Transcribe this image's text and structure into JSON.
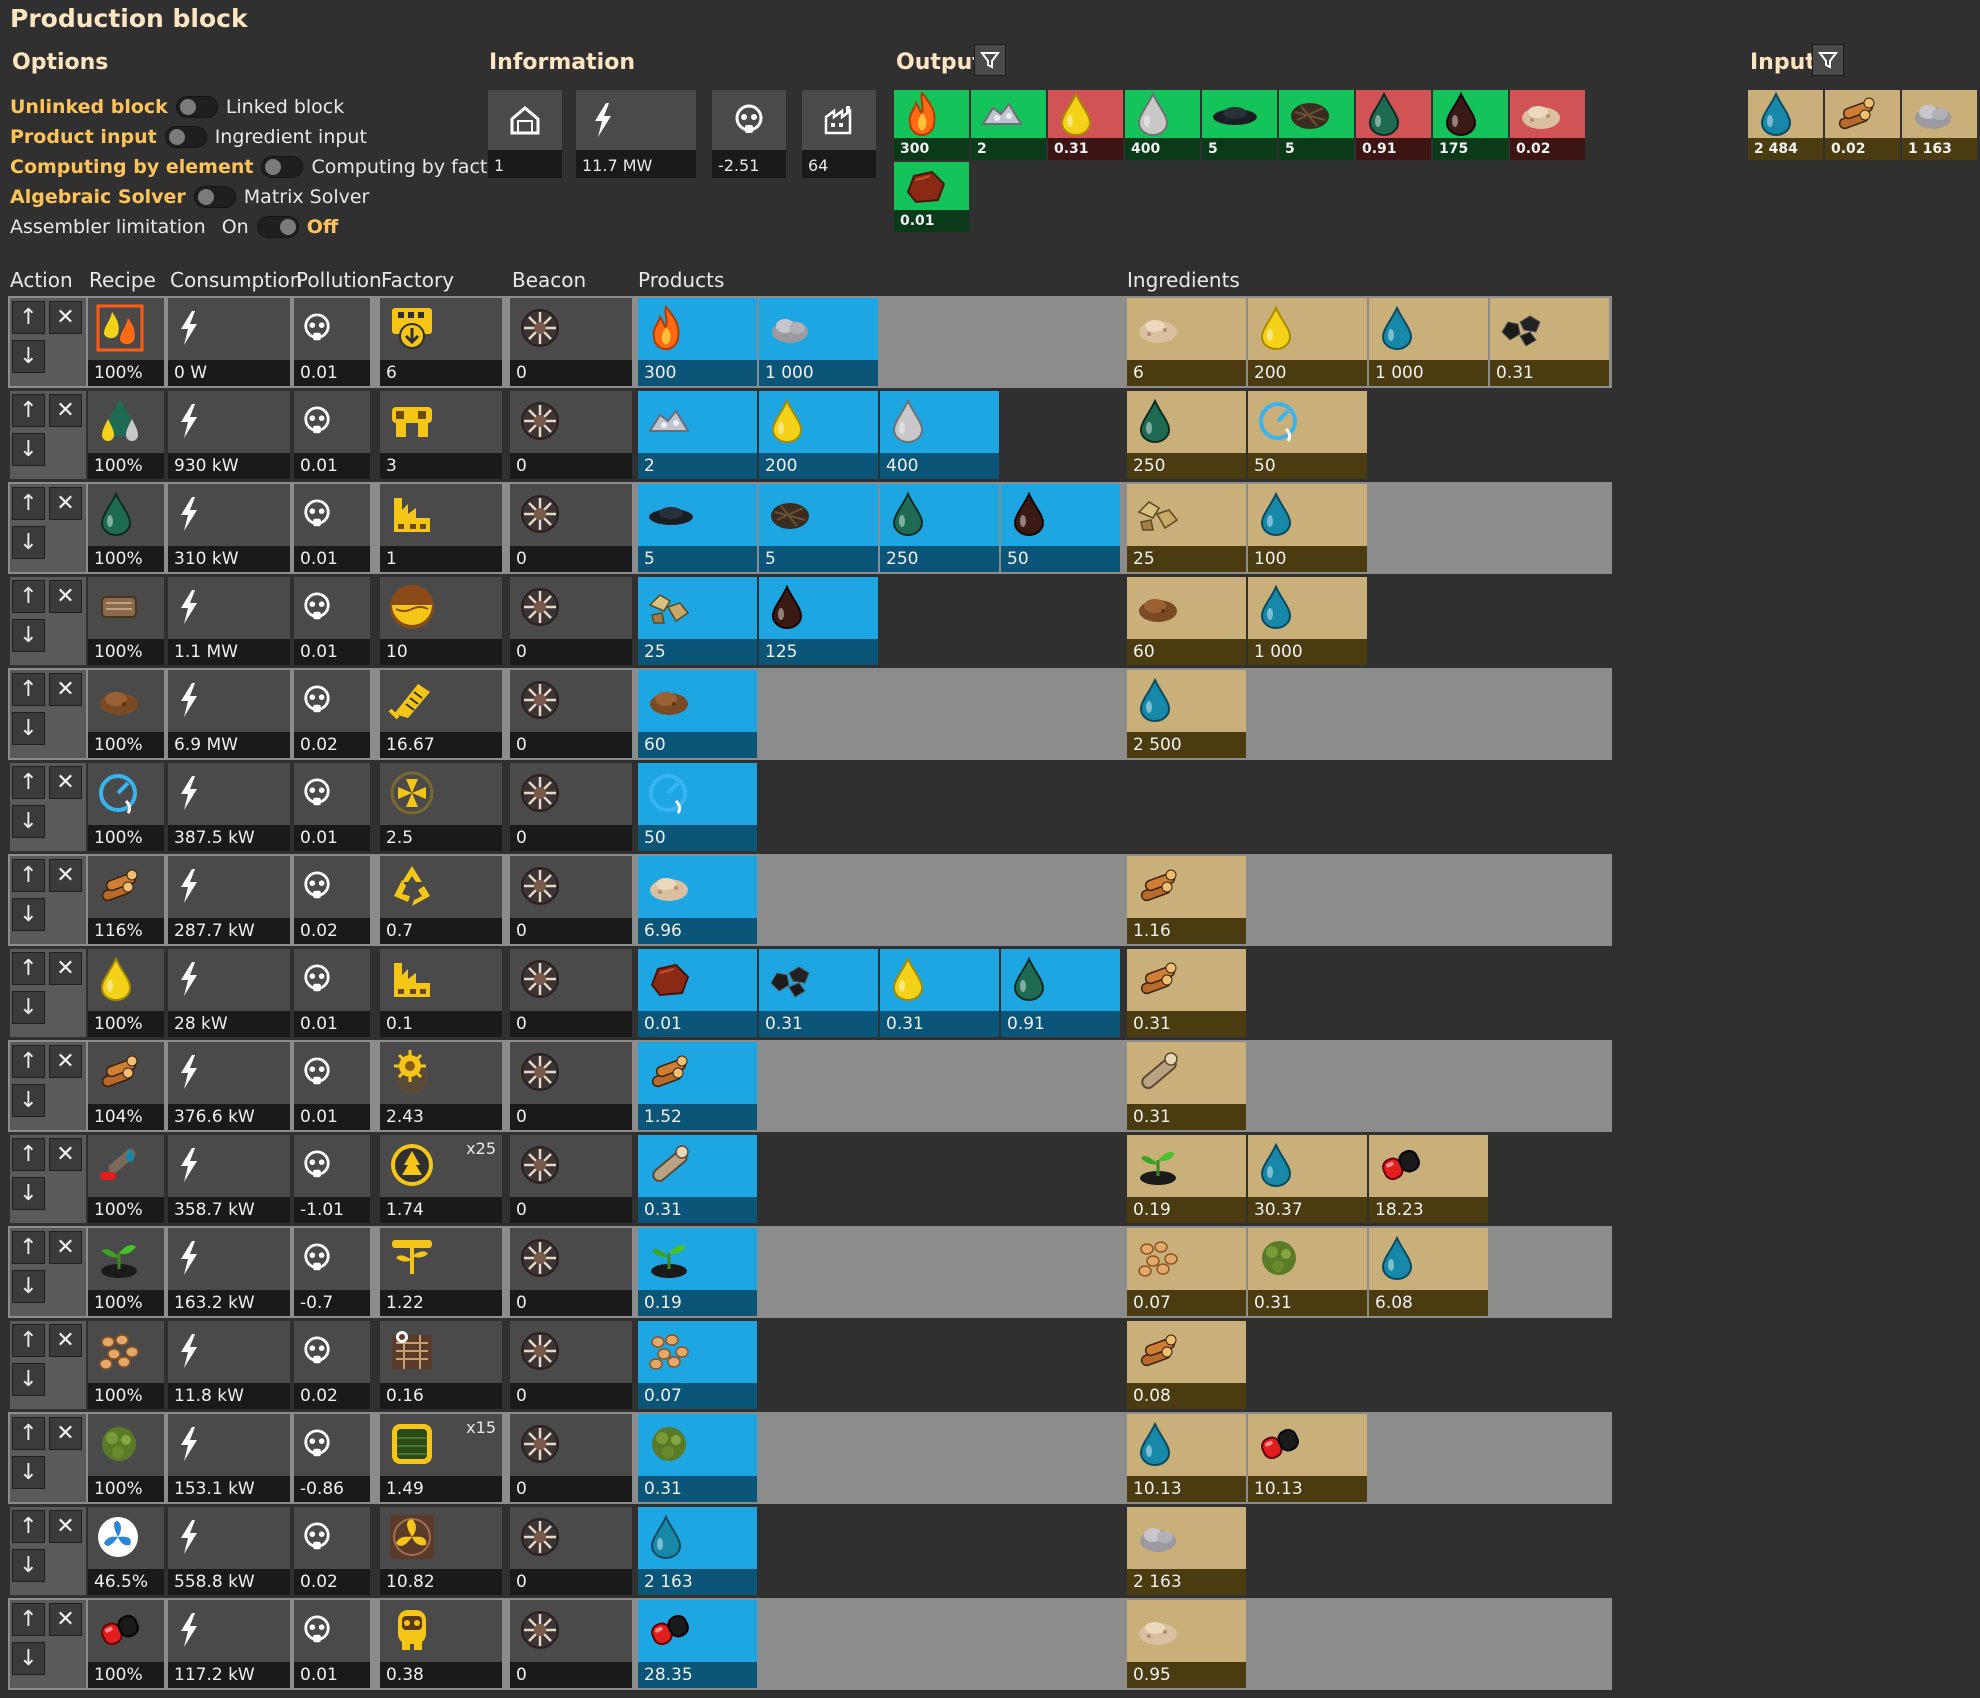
{
  "title": "Production block",
  "options": {
    "heading": "Options",
    "unlinked": "Unlinked block",
    "linked": "Linked block",
    "product_input": "Product input",
    "ingredient_input": "Ingredient input",
    "by_element": "Computing by element",
    "by_factory": "Computing by factory",
    "algebraic": "Algebraic Solver",
    "matrix": "Matrix Solver",
    "assembler_limit": "Assembler limitation",
    "on": "On",
    "off": "Off"
  },
  "information": {
    "heading": "Information",
    "block_count": "1",
    "power": "11.7 MW",
    "pollution": "-2.51",
    "factories": "64"
  },
  "output": {
    "heading": "Output",
    "items": [
      {
        "icon": "flame-fluid-icon",
        "value": "300",
        "status": "green"
      },
      {
        "icon": "ore-pile-icon",
        "value": "2",
        "status": "green"
      },
      {
        "icon": "yellow-drop-icon",
        "value": "0.31",
        "status": "red"
      },
      {
        "icon": "grey-drop-icon",
        "value": "400",
        "status": "green"
      },
      {
        "icon": "black-powder-icon",
        "value": "5",
        "status": "green"
      },
      {
        "icon": "brown-fibre-icon",
        "value": "5",
        "status": "green"
      },
      {
        "icon": "green-drop-icon",
        "value": "0.91",
        "status": "red"
      },
      {
        "icon": "dark-drop-icon",
        "value": "175",
        "status": "green"
      },
      {
        "icon": "sawdust-icon",
        "value": "0.02",
        "status": "red"
      },
      {
        "icon": "red-rock-icon",
        "value": "0.01",
        "status": "green"
      }
    ]
  },
  "input": {
    "heading": "Input",
    "items": [
      {
        "icon": "water-drop-icon",
        "value": "2 484"
      },
      {
        "icon": "wood-logs-icon",
        "value": "0.02"
      },
      {
        "icon": "ash-pile-icon",
        "value": "1 163"
      }
    ]
  },
  "columns": {
    "action": "Action",
    "recipe": "Recipe",
    "consumption": "Consumption",
    "pollution": "Pollution",
    "factory": "Factory",
    "beacon": "Beacon",
    "products": "Products",
    "ingredients": "Ingredients"
  },
  "rows": [
    {
      "recipe_icon": "burning-fluids-recipe-icon",
      "recipe_pct": "100%",
      "consumption": "0 W",
      "pollution": "0.01",
      "factory_icon": "boiler-icon",
      "factory_count": "6",
      "factory_tag": "",
      "beacon": "0",
      "products": [
        {
          "icon": "flame-fluid-icon",
          "value": "300"
        },
        {
          "icon": "ash-pile-icon",
          "value": "1 000"
        }
      ],
      "ingredients": [
        {
          "icon": "sawdust-icon",
          "value": "6"
        },
        {
          "icon": "yellow-drop-icon",
          "value": "200"
        },
        {
          "icon": "water-drop-icon",
          "value": "1 000"
        },
        {
          "icon": "coal-icon",
          "value": "0.31"
        }
      ]
    },
    {
      "recipe_icon": "oil-split-recipe-icon",
      "recipe_pct": "100%",
      "consumption": "930 kW",
      "pollution": "0.01",
      "factory_icon": "refinery-icon",
      "factory_count": "3",
      "factory_tag": "",
      "beacon": "0",
      "products": [
        {
          "icon": "ore-pile-icon",
          "value": "2"
        },
        {
          "icon": "yellow-drop-icon",
          "value": "200"
        },
        {
          "icon": "grey-drop-icon",
          "value": "400"
        }
      ],
      "ingredients": [
        {
          "icon": "green-drop-icon",
          "value": "250"
        },
        {
          "icon": "steam-gauge-icon",
          "value": "50"
        }
      ]
    },
    {
      "recipe_icon": "green-drop-icon",
      "recipe_pct": "100%",
      "consumption": "310 kW",
      "pollution": "0.01",
      "factory_icon": "chemical-plant-icon",
      "factory_count": "1",
      "factory_tag": "",
      "beacon": "0",
      "products": [
        {
          "icon": "black-powder-icon",
          "value": "5"
        },
        {
          "icon": "brown-fibre-icon",
          "value": "5"
        },
        {
          "icon": "green-drop-icon",
          "value": "250"
        },
        {
          "icon": "dark-drop-icon",
          "value": "50"
        }
      ],
      "ingredients": [
        {
          "icon": "rock-chunks-icon",
          "value": "25"
        },
        {
          "icon": "water-drop-icon",
          "value": "100"
        }
      ]
    },
    {
      "recipe_icon": "mud-sieve-recipe-icon",
      "recipe_pct": "100%",
      "consumption": "1.1 MW",
      "pollution": "0.01",
      "factory_icon": "washer-icon",
      "factory_count": "10",
      "factory_tag": "",
      "beacon": "0",
      "products": [
        {
          "icon": "rock-chunks-icon",
          "value": "25"
        },
        {
          "icon": "dark-drop-icon",
          "value": "125"
        }
      ],
      "ingredients": [
        {
          "icon": "dirt-pile-icon",
          "value": "60"
        },
        {
          "icon": "water-drop-icon",
          "value": "1 000"
        }
      ]
    },
    {
      "recipe_icon": "dirt-pile-icon",
      "recipe_pct": "100%",
      "consumption": "6.9 MW",
      "pollution": "0.02",
      "factory_icon": "excavator-icon",
      "factory_count": "16.67",
      "factory_tag": "",
      "beacon": "0",
      "products": [
        {
          "icon": "dirt-pile-icon",
          "value": "60"
        }
      ],
      "ingredients": [
        {
          "icon": "water-drop-icon",
          "value": "2 500"
        }
      ]
    },
    {
      "recipe_icon": "steam-gauge-icon",
      "recipe_pct": "100%",
      "consumption": "387.5 kW",
      "pollution": "0.01",
      "factory_icon": "centrifuge-icon",
      "factory_count": "2.5",
      "factory_tag": "",
      "beacon": "0",
      "products": [
        {
          "icon": "steam-gauge-icon",
          "value": "50"
        }
      ],
      "ingredients": []
    },
    {
      "recipe_icon": "wood-logs-icon",
      "recipe_pct": "116%",
      "consumption": "287.7 kW",
      "pollution": "0.02",
      "factory_icon": "recycler-icon",
      "factory_count": "0.7",
      "factory_tag": "",
      "beacon": "0",
      "products": [
        {
          "icon": "sawdust-icon",
          "value": "6.96"
        }
      ],
      "ingredients": [
        {
          "icon": "wood-logs-icon",
          "value": "1.16"
        }
      ]
    },
    {
      "recipe_icon": "yellow-drop-icon",
      "recipe_pct": "100%",
      "consumption": "28 kW",
      "pollution": "0.01",
      "factory_icon": "chemical-plant-icon",
      "factory_count": "0.1",
      "factory_tag": "",
      "beacon": "0",
      "products": [
        {
          "icon": "red-rock-icon",
          "value": "0.01"
        },
        {
          "icon": "coal-icon",
          "value": "0.31"
        },
        {
          "icon": "yellow-drop-icon",
          "value": "0.31"
        },
        {
          "icon": "green-drop-icon",
          "value": "0.91"
        }
      ],
      "ingredients": [
        {
          "icon": "wood-logs-icon",
          "value": "0.31"
        }
      ]
    },
    {
      "recipe_icon": "wood-logs-icon",
      "recipe_pct": "104%",
      "consumption": "376.6 kW",
      "pollution": "0.01",
      "factory_icon": "sawmill-icon",
      "factory_count": "2.43",
      "factory_tag": "",
      "beacon": "0",
      "products": [
        {
          "icon": "wood-logs-icon",
          "value": "1.52"
        }
      ],
      "ingredients": [
        {
          "icon": "single-log-icon",
          "value": "0.31"
        }
      ]
    },
    {
      "recipe_icon": "log-seed-recipe-icon",
      "recipe_pct": "100%",
      "consumption": "358.7 kW",
      "pollution": "-1.01",
      "factory_icon": "tree-farm-icon",
      "factory_count": "1.74",
      "factory_tag": "x25",
      "beacon": "0",
      "products": [
        {
          "icon": "single-log-icon",
          "value": "0.31"
        }
      ],
      "ingredients": [
        {
          "icon": "sapling-icon",
          "value": "0.19"
        },
        {
          "icon": "water-drop-icon",
          "value": "30.37"
        },
        {
          "icon": "red-canister-icon",
          "value": "18.23"
        }
      ]
    },
    {
      "recipe_icon": "sapling-icon",
      "recipe_pct": "100%",
      "consumption": "163.2 kW",
      "pollution": "-0.7",
      "factory_icon": "seed-planter-icon",
      "factory_count": "1.22",
      "factory_tag": "",
      "beacon": "0",
      "products": [
        {
          "icon": "sapling-icon",
          "value": "0.19"
        }
      ],
      "ingredients": [
        {
          "icon": "seeds-icon",
          "value": "0.07"
        },
        {
          "icon": "moss-icon",
          "value": "0.31"
        },
        {
          "icon": "water-drop-icon",
          "value": "6.08"
        }
      ]
    },
    {
      "recipe_icon": "seeds-icon",
      "recipe_pct": "100%",
      "consumption": "11.8 kW",
      "pollution": "0.02",
      "factory_icon": "seed-extractor-icon",
      "factory_count": "0.16",
      "factory_tag": "",
      "beacon": "0",
      "products": [
        {
          "icon": "seeds-icon",
          "value": "0.07"
        }
      ],
      "ingredients": [
        {
          "icon": "wood-logs-icon",
          "value": "0.08"
        }
      ]
    },
    {
      "recipe_icon": "moss-icon",
      "recipe_pct": "100%",
      "consumption": "153.1 kW",
      "pollution": "-0.86",
      "factory_icon": "moss-farm-icon",
      "factory_count": "1.49",
      "factory_tag": "x15",
      "beacon": "0",
      "products": [
        {
          "icon": "moss-icon",
          "value": "0.31"
        }
      ],
      "ingredients": [
        {
          "icon": "water-drop-icon",
          "value": "10.13"
        },
        {
          "icon": "red-canister-icon",
          "value": "10.13"
        }
      ]
    },
    {
      "recipe_icon": "offshore-pump-recipe-icon",
      "recipe_pct": "46.5%",
      "consumption": "558.8 kW",
      "pollution": "0.02",
      "factory_icon": "fan-pump-icon",
      "factory_count": "10.82",
      "factory_tag": "",
      "beacon": "0",
      "products": [
        {
          "icon": "water-drop-icon",
          "value": "2 163"
        }
      ],
      "ingredients": [
        {
          "icon": "ash-pile-icon",
          "value": "2 163"
        }
      ]
    },
    {
      "recipe_icon": "red-canister-icon",
      "recipe_pct": "100%",
      "consumption": "117.2 kW",
      "pollution": "0.01",
      "factory_icon": "compressor-icon",
      "factory_count": "0.38",
      "factory_tag": "",
      "beacon": "0",
      "products": [
        {
          "icon": "red-canister-icon",
          "value": "28.35"
        }
      ],
      "ingredients": [
        {
          "icon": "sawdust-icon",
          "value": "0.95"
        }
      ]
    }
  ]
}
